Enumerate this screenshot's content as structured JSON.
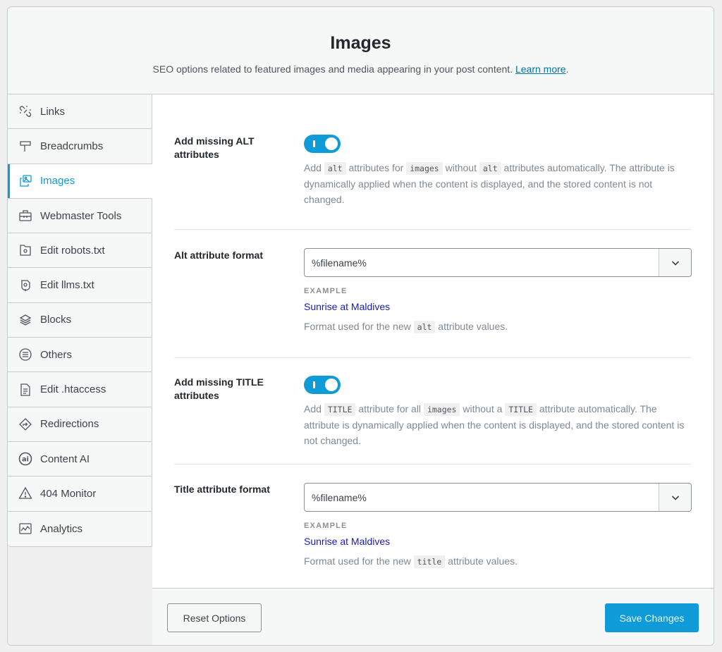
{
  "header": {
    "title": "Images",
    "description": "SEO options related to featured images and media appearing in your post content.",
    "learn_more": "Learn more",
    "period": "."
  },
  "sidebar": {
    "active": "Images",
    "items": [
      {
        "label": "Links",
        "icon": "links-icon"
      },
      {
        "label": "Breadcrumbs",
        "icon": "signpost-icon"
      },
      {
        "label": "Images",
        "icon": "images-icon"
      },
      {
        "label": "Webmaster Tools",
        "icon": "toolbox-icon"
      },
      {
        "label": "Edit robots.txt",
        "icon": "robots-file-icon"
      },
      {
        "label": "Edit llms.txt",
        "icon": "llms-file-icon"
      },
      {
        "label": "Blocks",
        "icon": "blocks-icon"
      },
      {
        "label": "Others",
        "icon": "list-circle-icon"
      },
      {
        "label": "Edit .htaccess",
        "icon": "htaccess-file-icon"
      },
      {
        "label": "Redirections",
        "icon": "redirect-icon"
      },
      {
        "label": "Content AI",
        "icon": "content-ai-icon"
      },
      {
        "label": "404 Monitor",
        "icon": "warning-icon"
      },
      {
        "label": "Analytics",
        "icon": "analytics-icon"
      }
    ]
  },
  "settings": {
    "alt_toggle": {
      "label": "Add missing ALT attributes",
      "enabled": true,
      "d1": "Add ",
      "c1": "alt",
      "d2": " attributes for ",
      "c2": "images",
      "d3": " without ",
      "c3": "alt",
      "d4": " attributes automatically. The attribute is dynamically applied when the content is displayed, and the stored content is not changed."
    },
    "alt_format": {
      "label": "Alt attribute format",
      "value": "%filename%",
      "example_label": "EXAMPLE",
      "example_value": "Sunrise at Maldives",
      "d1": "Format used for the new ",
      "c1": "alt",
      "d2": " attribute values."
    },
    "title_toggle": {
      "label": "Add missing TITLE attributes",
      "enabled": true,
      "d1": "Add ",
      "c1": "TITLE",
      "d2": " attribute for all ",
      "c2": "images",
      "d3": " without a ",
      "c3": "TITLE",
      "d4": " attribute automatically. The attribute is dynamically applied when the content is displayed, and the stored content is not changed."
    },
    "title_format": {
      "label": "Title attribute format",
      "value": "%filename%",
      "example_label": "EXAMPLE",
      "example_value": "Sunrise at Maldives",
      "d1": "Format used for the new ",
      "c1": "title",
      "d2": " attribute values."
    }
  },
  "footer": {
    "reset_label": "Reset Options",
    "save_label": "Save Changes"
  },
  "colors": {
    "accent": "#0e9bd8",
    "link": "#0073aa",
    "example": "#1a1ab8"
  }
}
